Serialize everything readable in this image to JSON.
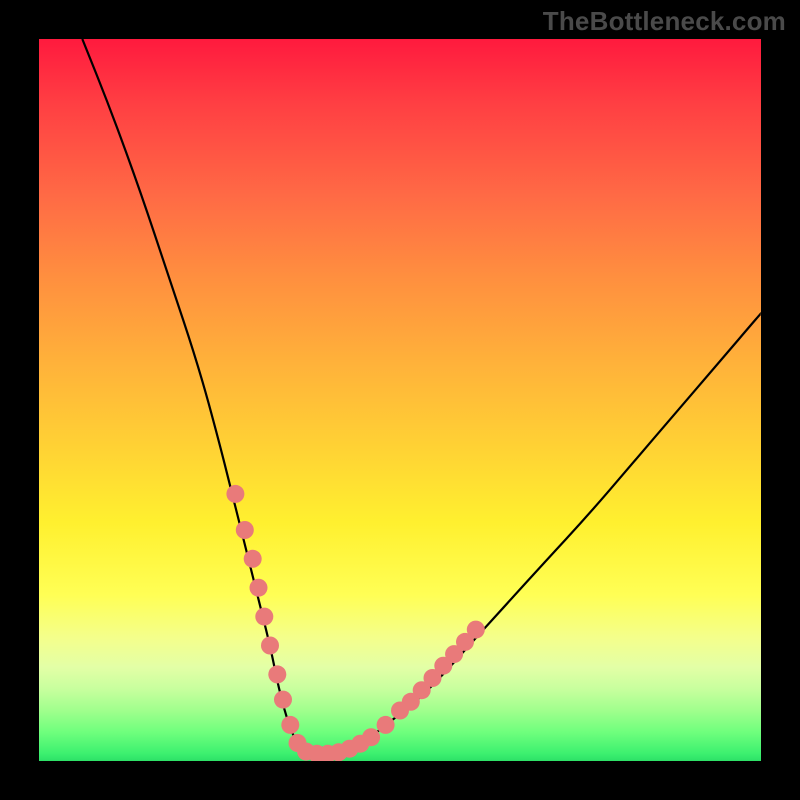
{
  "watermark": "TheBottleneck.com",
  "chart_data": {
    "type": "line",
    "title": "",
    "xlabel": "",
    "ylabel": "",
    "xlim": [
      0,
      100
    ],
    "ylim": [
      0,
      100
    ],
    "grid": false,
    "legend": false,
    "series": [
      {
        "name": "bottleneck-curve",
        "color": "#000000",
        "x": [
          6,
          10,
          14,
          18,
          22,
          25,
          27,
          29,
          30.5,
          32,
          33,
          34,
          35,
          36,
          37,
          38,
          40,
          42,
          45,
          48,
          52,
          56,
          60,
          65,
          70,
          76,
          82,
          88,
          94,
          100
        ],
        "y": [
          100,
          90,
          79,
          67,
          55,
          44,
          36,
          28,
          22,
          16,
          11,
          7,
          4,
          2,
          1.2,
          1,
          1,
          1.4,
          2.5,
          5,
          8,
          12,
          16.5,
          22,
          27.5,
          34,
          41,
          48,
          55,
          62
        ]
      }
    ],
    "markers": [
      {
        "name": "highlight-dots",
        "color": "#e97a7a",
        "points": [
          {
            "x": 27.2,
            "y": 37
          },
          {
            "x": 28.5,
            "y": 32
          },
          {
            "x": 29.6,
            "y": 28
          },
          {
            "x": 30.4,
            "y": 24
          },
          {
            "x": 31.2,
            "y": 20
          },
          {
            "x": 32.0,
            "y": 16
          },
          {
            "x": 33.0,
            "y": 12
          },
          {
            "x": 33.8,
            "y": 8.5
          },
          {
            "x": 34.8,
            "y": 5
          },
          {
            "x": 35.8,
            "y": 2.5
          },
          {
            "x": 37.0,
            "y": 1.3
          },
          {
            "x": 38.5,
            "y": 1
          },
          {
            "x": 40.0,
            "y": 1
          },
          {
            "x": 41.5,
            "y": 1.2
          },
          {
            "x": 43.0,
            "y": 1.7
          },
          {
            "x": 44.5,
            "y": 2.4
          },
          {
            "x": 46.0,
            "y": 3.3
          },
          {
            "x": 48.0,
            "y": 5
          },
          {
            "x": 50.0,
            "y": 7
          },
          {
            "x": 51.5,
            "y": 8.2
          },
          {
            "x": 53.0,
            "y": 9.8
          },
          {
            "x": 54.5,
            "y": 11.5
          },
          {
            "x": 56.0,
            "y": 13.2
          },
          {
            "x": 57.5,
            "y": 14.8
          },
          {
            "x": 59.0,
            "y": 16.5
          },
          {
            "x": 60.5,
            "y": 18.2
          }
        ]
      }
    ],
    "gradient_stops": [
      {
        "pos": 0,
        "color": "#ff1a3e"
      },
      {
        "pos": 22,
        "color": "#ff6b45"
      },
      {
        "pos": 45,
        "color": "#ffb23a"
      },
      {
        "pos": 67,
        "color": "#fff02f"
      },
      {
        "pos": 83,
        "color": "#f4ff8c"
      },
      {
        "pos": 93,
        "color": "#a0ff8d"
      },
      {
        "pos": 100,
        "color": "#2de067"
      }
    ]
  }
}
